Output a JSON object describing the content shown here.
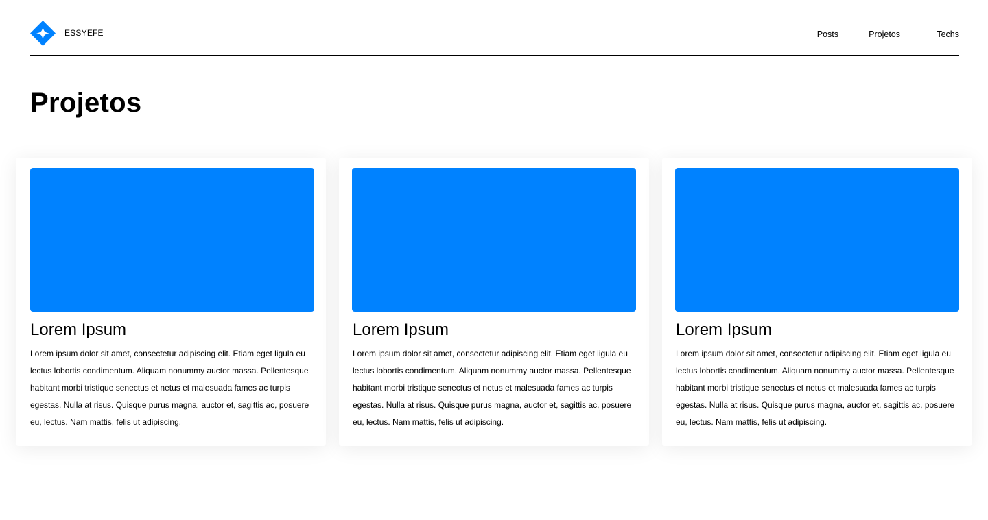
{
  "header": {
    "brand": "ESSYEFE",
    "logo_icon": "diamond-star-logo-icon",
    "nav": [
      {
        "label": "Posts"
      },
      {
        "label": "Projetos"
      },
      {
        "label": "Techs"
      }
    ]
  },
  "main": {
    "title": "Projetos",
    "cards": [
      {
        "title": "Lorem Ipsum",
        "text": "Lorem ipsum dolor sit amet, consectetur adipiscing elit. Etiam eget ligula eu lectus lobortis condimentum. Aliquam nonummy auctor massa. Pellentesque habitant morbi tristique senectus et netus et malesuada fames ac turpis egestas. Nulla at risus. Quisque purus magna, auctor et, sagittis ac, posuere eu, lectus. Nam mattis, felis ut adipiscing."
      },
      {
        "title": "Lorem Ipsum",
        "text": "Lorem ipsum dolor sit amet, consectetur adipiscing elit. Etiam eget ligula eu lectus lobortis condimentum. Aliquam nonummy auctor massa. Pellentesque habitant morbi tristique senectus et netus et malesuada fames ac turpis egestas. Nulla at risus. Quisque purus magna, auctor et, sagittis ac, posuere eu, lectus. Nam mattis, felis ut adipiscing."
      },
      {
        "title": "Lorem Ipsum",
        "text": "Lorem ipsum dolor sit amet, consectetur adipiscing elit. Etiam eget ligula eu lectus lobortis condimentum. Aliquam nonummy auctor massa. Pellentesque habitant morbi tristique senectus et netus et malesuada fames ac turpis egestas. Nulla at risus. Quisque purus magna, auctor et, sagittis ac, posuere eu, lectus. Nam mattis, felis ut adipiscing."
      }
    ]
  },
  "colors": {
    "accent": "#0082ff",
    "text": "#000000",
    "background": "#ffffff"
  }
}
